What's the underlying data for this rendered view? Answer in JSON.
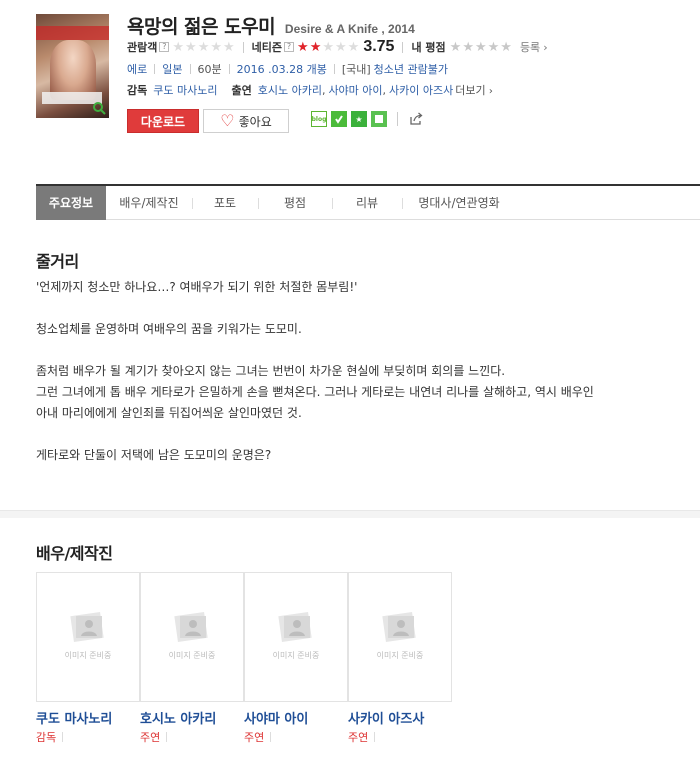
{
  "movie": {
    "title_ko": "욕망의 젊은 도우미",
    "title_en": "Desire & A Knife , 2014"
  },
  "ratings": {
    "audience_label": "관람객",
    "audience_stars": 0,
    "netizen_label": "네티즌",
    "netizen_stars": 2,
    "netizen_score": "3.75",
    "my_label": "내 평점",
    "my_stars": 0,
    "register_label": "등록"
  },
  "meta": {
    "genre": "에로",
    "country": "일본",
    "runtime": "60분",
    "release": "2016 .03.28 개봉",
    "rating_prefix": "[국내]",
    "rating": "청소년 관람불가"
  },
  "credits": {
    "director_label": "감독",
    "director": "쿠도 마사노리",
    "cast_label": "출연",
    "cast": [
      "호시노 아카리",
      "사야마 아이",
      "사카이 아즈사"
    ],
    "more_label": "더보기"
  },
  "buttons": {
    "download": "다운로드",
    "like": "좋아요"
  },
  "share": {
    "blog_label": "blog"
  },
  "tabs": [
    "주요정보",
    "배우/제작진",
    "포토",
    "평점",
    "리뷰",
    "명대사/연관영화"
  ],
  "synopsis": {
    "title": "줄거리",
    "lines": [
      "'언제까지 청소만 하나요…? 여배우가 되기 위한 처절한 몸부림!'",
      "",
      " 청소업체를 운영하며 여배우의 꿈을 키워가는 도모미.",
      "",
      " 좀처럼 배우가 될 계기가 찾아오지 않는 그녀는 번번이 차가운 현실에 부딪히며 회의를 느낀다.",
      " 그런 그녀에게 톱 배우 게타로가 은밀하게 손을 뻗쳐온다. 그러나 게타로는 내연녀 리나를 살해하고, 역시 배우인",
      " 아내 마리에에게 살인죄를 뒤집어씌운 살인마였던 것.",
      "",
      " 게타로와 단둘이 저택에 남은 도모미의 운명은?"
    ]
  },
  "cast_section": {
    "title": "배우/제작진",
    "placeholder_text": "이미지 준비중",
    "people": [
      {
        "name": "쿠도 마사노리",
        "role": "감독"
      },
      {
        "name": "호시노 아카리",
        "role": "주연"
      },
      {
        "name": "사야마 아이",
        "role": "주연"
      },
      {
        "name": "사카이 아즈사",
        "role": "주연"
      }
    ]
  },
  "colors": {
    "accent_red": "#e03b3b",
    "link_blue": "#2f5fa7",
    "name_blue": "#1f4e96",
    "tab_active_bg": "#7a7a7a"
  }
}
